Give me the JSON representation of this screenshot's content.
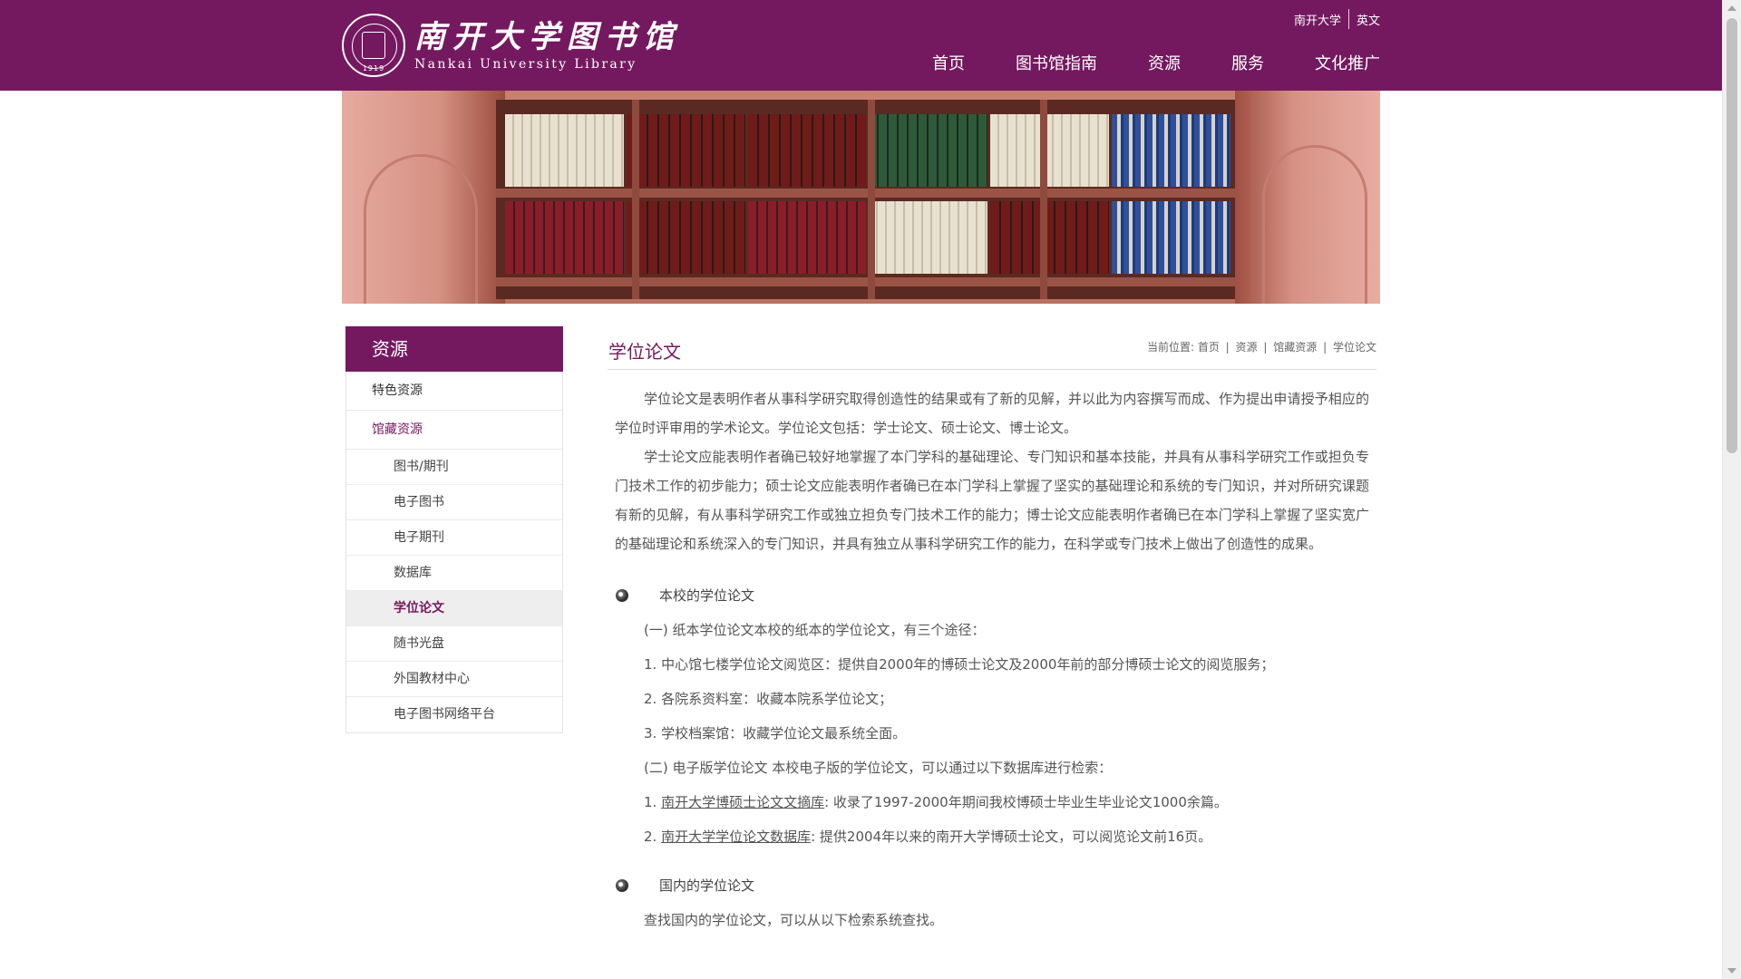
{
  "header": {
    "logo_cn": "南开大学图书馆",
    "logo_en": "Nankai University Library",
    "seal_year": "1919",
    "toplinks": [
      "南开大学",
      "英文"
    ],
    "nav": [
      "首页",
      "图书馆指南",
      "资源",
      "服务",
      "文化推广"
    ]
  },
  "sidebar": {
    "title": "资源",
    "items": [
      {
        "label": "特色资源"
      },
      {
        "label": "馆藏资源"
      }
    ],
    "sub_items": [
      {
        "label": "图书/期刊"
      },
      {
        "label": "电子图书"
      },
      {
        "label": "电子期刊"
      },
      {
        "label": "数据库"
      },
      {
        "label": "学位论文"
      },
      {
        "label": "随书光盘"
      },
      {
        "label": "外国教材中心"
      },
      {
        "label": "电子图书网络平台"
      }
    ]
  },
  "main": {
    "title": "学位论文",
    "breadcrumb": {
      "prefix": "当前位置:",
      "items": [
        "首页",
        "资源",
        "馆藏资源",
        "学位论文"
      ],
      "sep": "|"
    },
    "paragraphs": [
      "学位论文是表明作者从事科学研究取得创造性的结果或有了新的见解，并以此为内容撰写而成、作为提出申请授予相应的学位时评审用的学术论文。学位论文包括：学士论文、硕士论文、博士论文。",
      "学士论文应能表明作者确已较好地掌握了本门学科的基础理论、专门知识和基本技能，并具有从事科学研究工作或担负专门技术工作的初步能力；硕士论文应能表明作者确已在本门学科上掌握了坚实的基础理论和系统的专门知识，并对所研究课题有新的见解，有从事科学研究工作或独立担负专门技术工作的能力；博士论文应能表明作者确已在本门学科上掌握了坚实宽广的基础理论和系统深入的专门知识，并具有独立从事科学研究工作的能力，在科学或专门技术上做出了创造性的成果。"
    ],
    "section1": {
      "title": "本校的学位论文",
      "lines": [
        "(一) 纸本学位论文本校的纸本的学位论文，有三个途径：",
        "1. 中心馆七楼学位论文阅览区：提供自2000年的博硕士论文及2000年前的部分博硕士论文的阅览服务；",
        "2. 各院系资料室：收藏本院系学位论文；",
        "3. 学校档案馆：收藏学位论文最系统全面。",
        "(二) 电子版学位论文  本校电子版的学位论文，可以通过以下数据库进行检索："
      ],
      "db1": {
        "prefix": "1. ",
        "link": "南开大学博硕士论文文摘库",
        "text": ": 收录了1997-2000年期间我校博硕士毕业生毕业论文1000余篇。"
      },
      "db2": {
        "prefix": "2. ",
        "link": "南开大学学位论文数据库",
        "text": ": 提供2004年以来的南开大学博硕士论文，可以阅览论文前16页。"
      }
    },
    "section2": {
      "title": "国内的学位论文",
      "lines": [
        "查找国内的学位论文，可以从以下检索系统查找。"
      ]
    }
  },
  "colors": {
    "brand": "#74195f",
    "sidebar_selected_bg": "#eeeeee"
  }
}
